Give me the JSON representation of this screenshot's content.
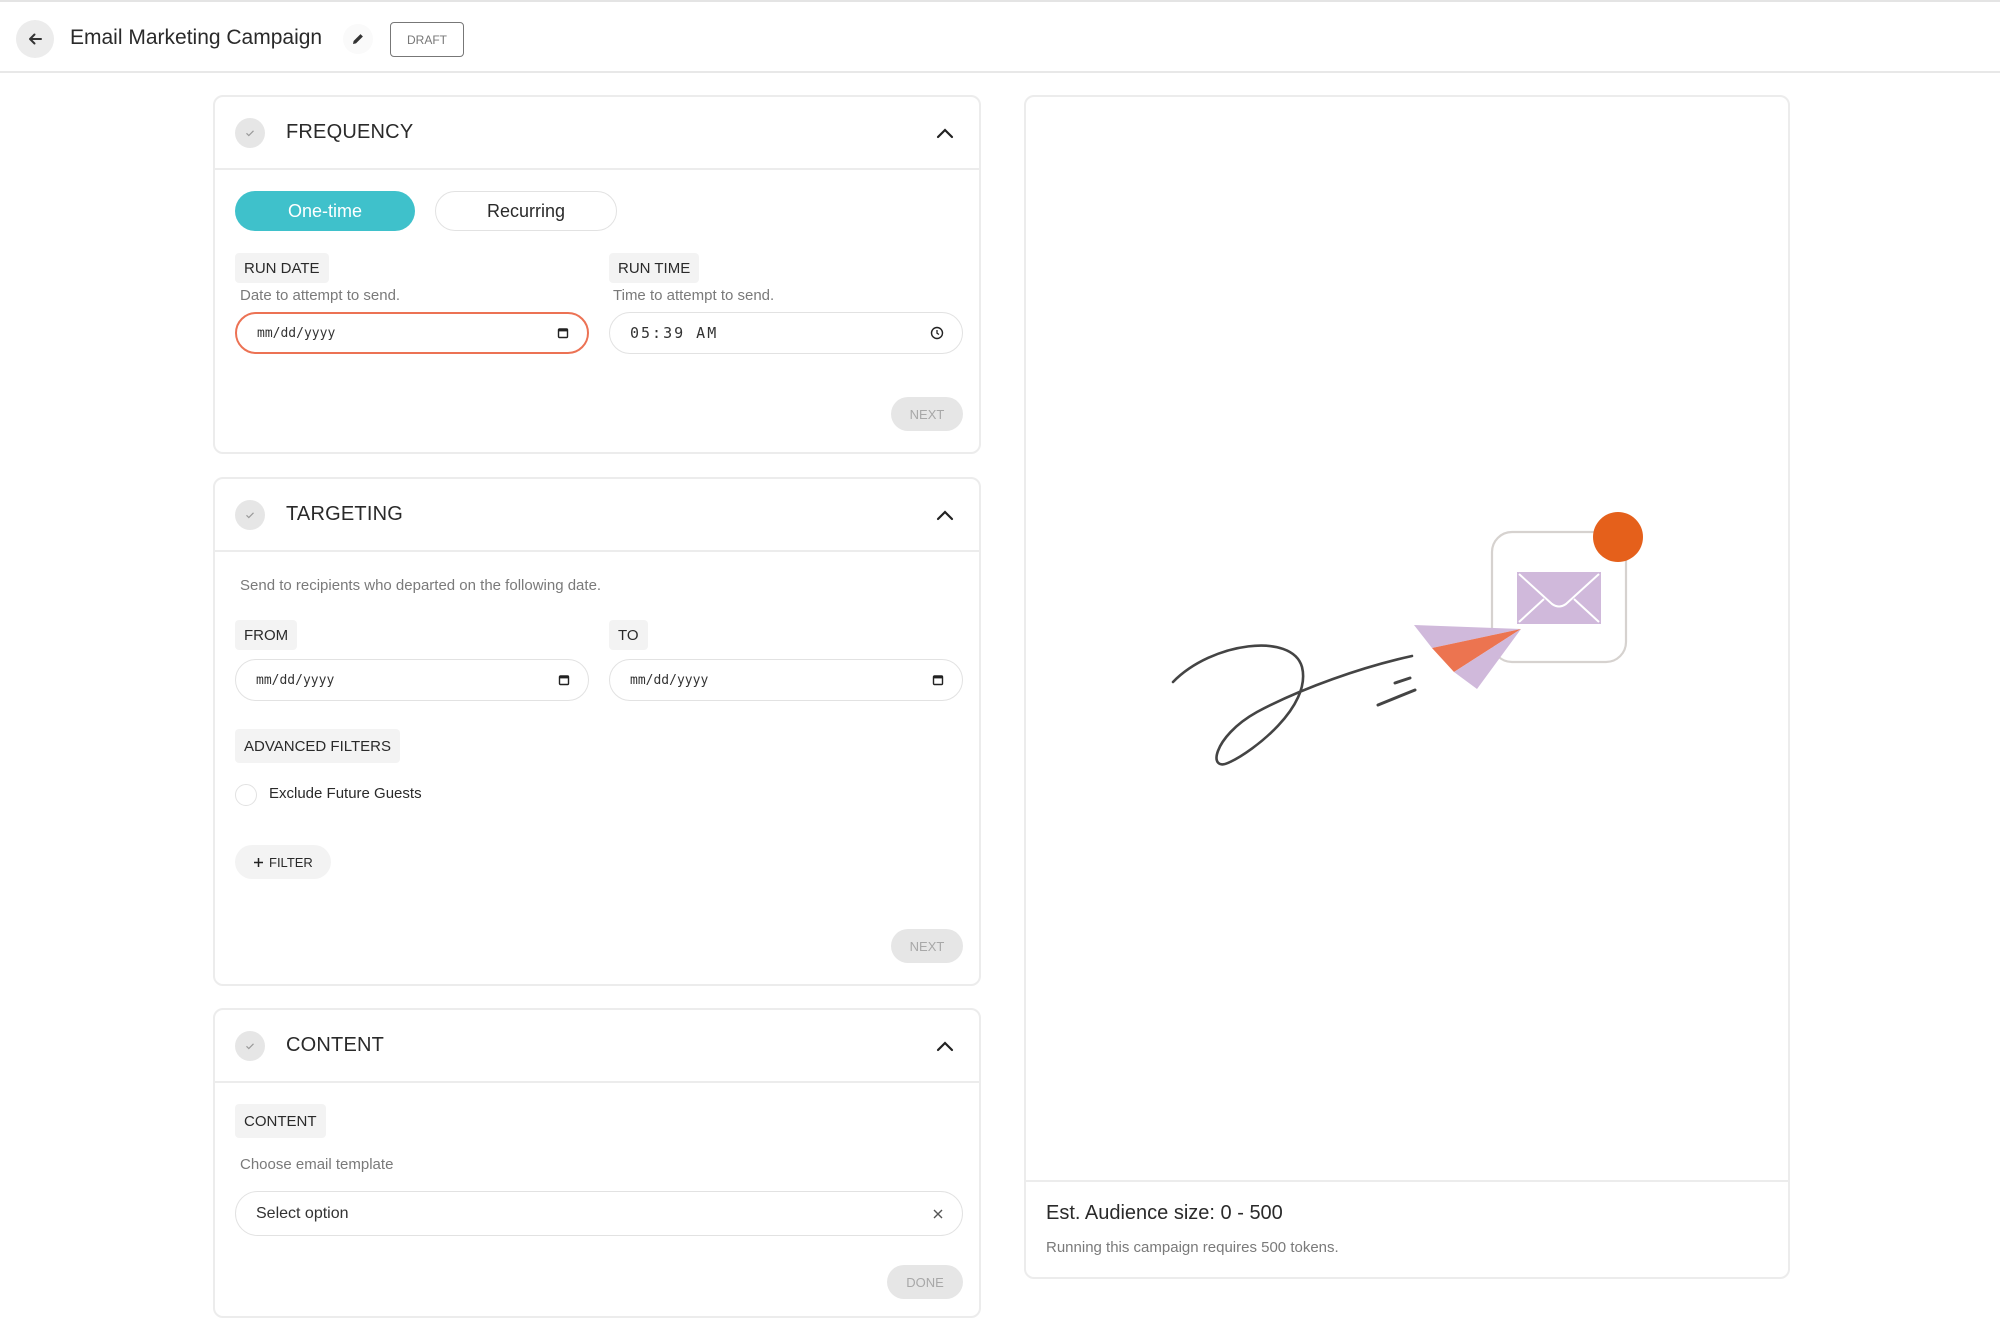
{
  "header": {
    "title": "Email Marketing Campaign",
    "status_badge": "DRAFT"
  },
  "frequency": {
    "title": "FREQUENCY",
    "options": [
      "One-time",
      "Recurring"
    ],
    "selected": "One-time",
    "run_date": {
      "label": "RUN DATE",
      "helper": "Date to attempt to send.",
      "placeholder": "mm/dd/yyyy",
      "value": ""
    },
    "run_time": {
      "label": "RUN TIME",
      "helper": "Time to attempt to send.",
      "value": "05:39 AM"
    },
    "next_label": "NEXT"
  },
  "targeting": {
    "title": "TARGETING",
    "description": "Send to recipients who departed on the following date.",
    "from": {
      "label": "FROM",
      "placeholder": "mm/dd/yyyy",
      "value": ""
    },
    "to": {
      "label": "TO",
      "placeholder": "mm/dd/yyyy",
      "value": ""
    },
    "advanced_filters_label": "ADVANCED FILTERS",
    "exclude_future_guests": {
      "label": "Exclude Future Guests",
      "checked": false
    },
    "add_filter_label": "FILTER",
    "next_label": "NEXT"
  },
  "content": {
    "title": "CONTENT",
    "field_label": "CONTENT",
    "helper": "Choose email template",
    "select_placeholder": "Select option",
    "done_label": "DONE"
  },
  "preview": {
    "audience_size": "Est. Audience size: 0 - 500",
    "tokens_note": "Running this campaign requires 500 tokens."
  },
  "colors": {
    "accent": "#3fc1cb",
    "error_border": "#ec7254",
    "notification_dot": "#e5601b",
    "envelope": "#d0b9db",
    "plane_orange": "#ec7450"
  }
}
